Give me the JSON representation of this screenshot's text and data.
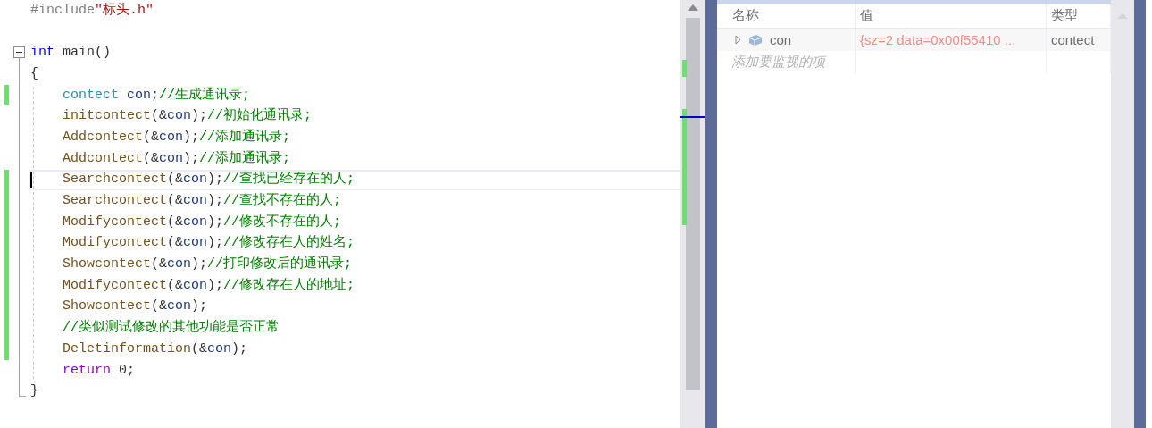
{
  "editor": {
    "lines": [
      {
        "changed": false,
        "current": false,
        "tokens": [
          {
            "text": "#include",
            "kind": "preproc"
          },
          {
            "text": "\"标头.h\"",
            "kind": "string"
          }
        ]
      },
      {
        "changed": false,
        "current": false,
        "tokens": [
          {
            "text": "int",
            "kind": "keyword"
          },
          {
            "text": " main()",
            "kind": "plain"
          }
        ],
        "children": [
          {
            "changed": false,
            "current": false,
            "indented": false,
            "tokens": [
              {
                "text": "{",
                "kind": "plain"
              }
            ]
          },
          {
            "changed": true,
            "current": false,
            "indented": true,
            "tokens": [
              {
                "text": "contect",
                "kind": "type"
              },
              {
                "text": " con",
                "kind": "var"
              },
              {
                "text": ";",
                "kind": "plain"
              },
              {
                "text": "//生成通讯录;",
                "kind": "comment"
              }
            ]
          },
          {
            "changed": false,
            "current": false,
            "indented": true,
            "tokens": [
              {
                "text": "initcontect",
                "kind": "func"
              },
              {
                "text": "(&",
                "kind": "plain"
              },
              {
                "text": "con",
                "kind": "var"
              },
              {
                "text": ");",
                "kind": "plain"
              },
              {
                "text": "//初始化通讯录;",
                "kind": "comment"
              }
            ]
          },
          {
            "changed": false,
            "current": false,
            "indented": true,
            "tokens": [
              {
                "text": "Addcontect",
                "kind": "func"
              },
              {
                "text": "(&",
                "kind": "plain"
              },
              {
                "text": "con",
                "kind": "var"
              },
              {
                "text": ");",
                "kind": "plain"
              },
              {
                "text": "//添加通讯录;",
                "kind": "comment"
              }
            ]
          },
          {
            "changed": false,
            "current": false,
            "indented": true,
            "tokens": [
              {
                "text": "Addcontect",
                "kind": "func"
              },
              {
                "text": "(&",
                "kind": "plain"
              },
              {
                "text": "con",
                "kind": "var"
              },
              {
                "text": ");",
                "kind": "plain"
              },
              {
                "text": "//添加通讯录;",
                "kind": "comment"
              }
            ]
          },
          {
            "changed": true,
            "current": true,
            "indented": true,
            "tokens": [
              {
                "text": "Searchcontect",
                "kind": "func"
              },
              {
                "text": "(&",
                "kind": "plain"
              },
              {
                "text": "con",
                "kind": "var"
              },
              {
                "text": ");",
                "kind": "plain"
              },
              {
                "text": "//查找已经存在的人;",
                "kind": "comment"
              }
            ]
          },
          {
            "changed": true,
            "current": false,
            "indented": true,
            "tokens": [
              {
                "text": "Searchcontect",
                "kind": "func"
              },
              {
                "text": "(&",
                "kind": "plain"
              },
              {
                "text": "con",
                "kind": "var"
              },
              {
                "text": ");",
                "kind": "plain"
              },
              {
                "text": "//查找不存在的人;",
                "kind": "comment"
              }
            ]
          },
          {
            "changed": true,
            "current": false,
            "indented": true,
            "tokens": [
              {
                "text": "Modifycontect",
                "kind": "func"
              },
              {
                "text": "(&",
                "kind": "plain"
              },
              {
                "text": "con",
                "kind": "var"
              },
              {
                "text": ");",
                "kind": "plain"
              },
              {
                "text": "//修改不存在的人;",
                "kind": "comment"
              }
            ]
          },
          {
            "changed": true,
            "current": false,
            "indented": true,
            "tokens": [
              {
                "text": "Modifycontect",
                "kind": "func"
              },
              {
                "text": "(&",
                "kind": "plain"
              },
              {
                "text": "con",
                "kind": "var"
              },
              {
                "text": ");",
                "kind": "plain"
              },
              {
                "text": "//修改存在人的姓名;",
                "kind": "comment"
              }
            ]
          },
          {
            "changed": true,
            "current": false,
            "indented": true,
            "tokens": [
              {
                "text": "Showcontect",
                "kind": "func"
              },
              {
                "text": "(&",
                "kind": "plain"
              },
              {
                "text": "con",
                "kind": "var"
              },
              {
                "text": ");",
                "kind": "plain"
              },
              {
                "text": "//打印修改后的通讯录;",
                "kind": "comment"
              }
            ]
          },
          {
            "changed": true,
            "current": false,
            "indented": true,
            "tokens": [
              {
                "text": "Modifycontect",
                "kind": "func"
              },
              {
                "text": "(&",
                "kind": "plain"
              },
              {
                "text": "con",
                "kind": "var"
              },
              {
                "text": ");",
                "kind": "plain"
              },
              {
                "text": "//修改存在人的地址;",
                "kind": "comment"
              }
            ]
          },
          {
            "changed": true,
            "current": false,
            "indented": true,
            "tokens": [
              {
                "text": "Showcontect",
                "kind": "func"
              },
              {
                "text": "(&",
                "kind": "plain"
              },
              {
                "text": "con",
                "kind": "var"
              },
              {
                "text": ");",
                "kind": "plain"
              }
            ]
          },
          {
            "changed": true,
            "current": false,
            "indented": true,
            "tokens": [
              {
                "text": "//类似测试修改的其他功能是否正常",
                "kind": "comment"
              }
            ]
          },
          {
            "changed": true,
            "current": false,
            "indented": true,
            "tokens": [
              {
                "text": "Deletinformation",
                "kind": "func"
              },
              {
                "text": "(&",
                "kind": "plain"
              },
              {
                "text": "con",
                "kind": "var"
              },
              {
                "text": ");",
                "kind": "plain"
              }
            ]
          },
          {
            "changed": false,
            "current": false,
            "indented": true,
            "tokens": [
              {
                "text": "return",
                "kind": "control"
              },
              {
                "text": " 0;",
                "kind": "plain"
              }
            ]
          },
          {
            "changed": false,
            "current": false,
            "indented": false,
            "tokens": [
              {
                "text": "}",
                "kind": "plain"
              }
            ]
          }
        ]
      }
    ]
  },
  "watch": {
    "columns": [
      "名称",
      "值",
      "类型"
    ],
    "rows": [
      {
        "name": "con",
        "value": "{sz=2 data=0x00f55410 ...",
        "type": "contect",
        "expanded": false
      }
    ],
    "placeholder": "添加要监视的项"
  }
}
